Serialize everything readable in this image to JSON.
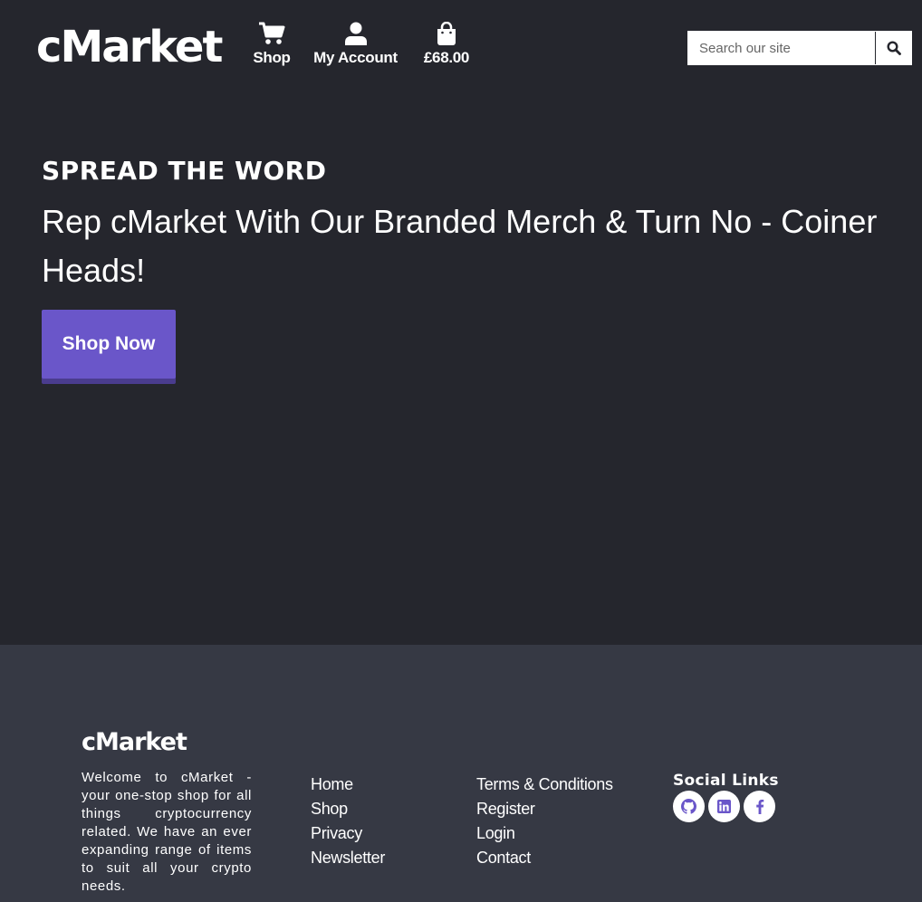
{
  "header": {
    "logo": "cMarket",
    "nav": {
      "shop_label": "Shop",
      "account_label": "My Account",
      "bag_total": "£68.00"
    },
    "search": {
      "placeholder": "Search our site"
    }
  },
  "hero": {
    "kicker": "Spread The Word",
    "title": "Rep cMarket With Our Branded Merch & Turn No - Coiner Heads!",
    "cta_label": "Shop Now"
  },
  "footer": {
    "logo": "cMarket",
    "about": "Welcome to cMarket - your one-stop shop for all things cryptocurrency related. We have an ever expanding range of items to suit all your crypto needs.",
    "links_col1": [
      "Home",
      "Shop",
      "Privacy",
      "Newsletter"
    ],
    "links_col2": [
      "Terms & Conditions",
      "Register",
      "Login",
      "Contact"
    ],
    "social_title": "Social Links",
    "social_icons": [
      "github-icon",
      "linkedin-icon",
      "facebook-icon"
    ]
  },
  "colors": {
    "background": "#25262d",
    "footer_background": "#363944",
    "accent": "#6a56c9",
    "text": "#ffffff"
  }
}
